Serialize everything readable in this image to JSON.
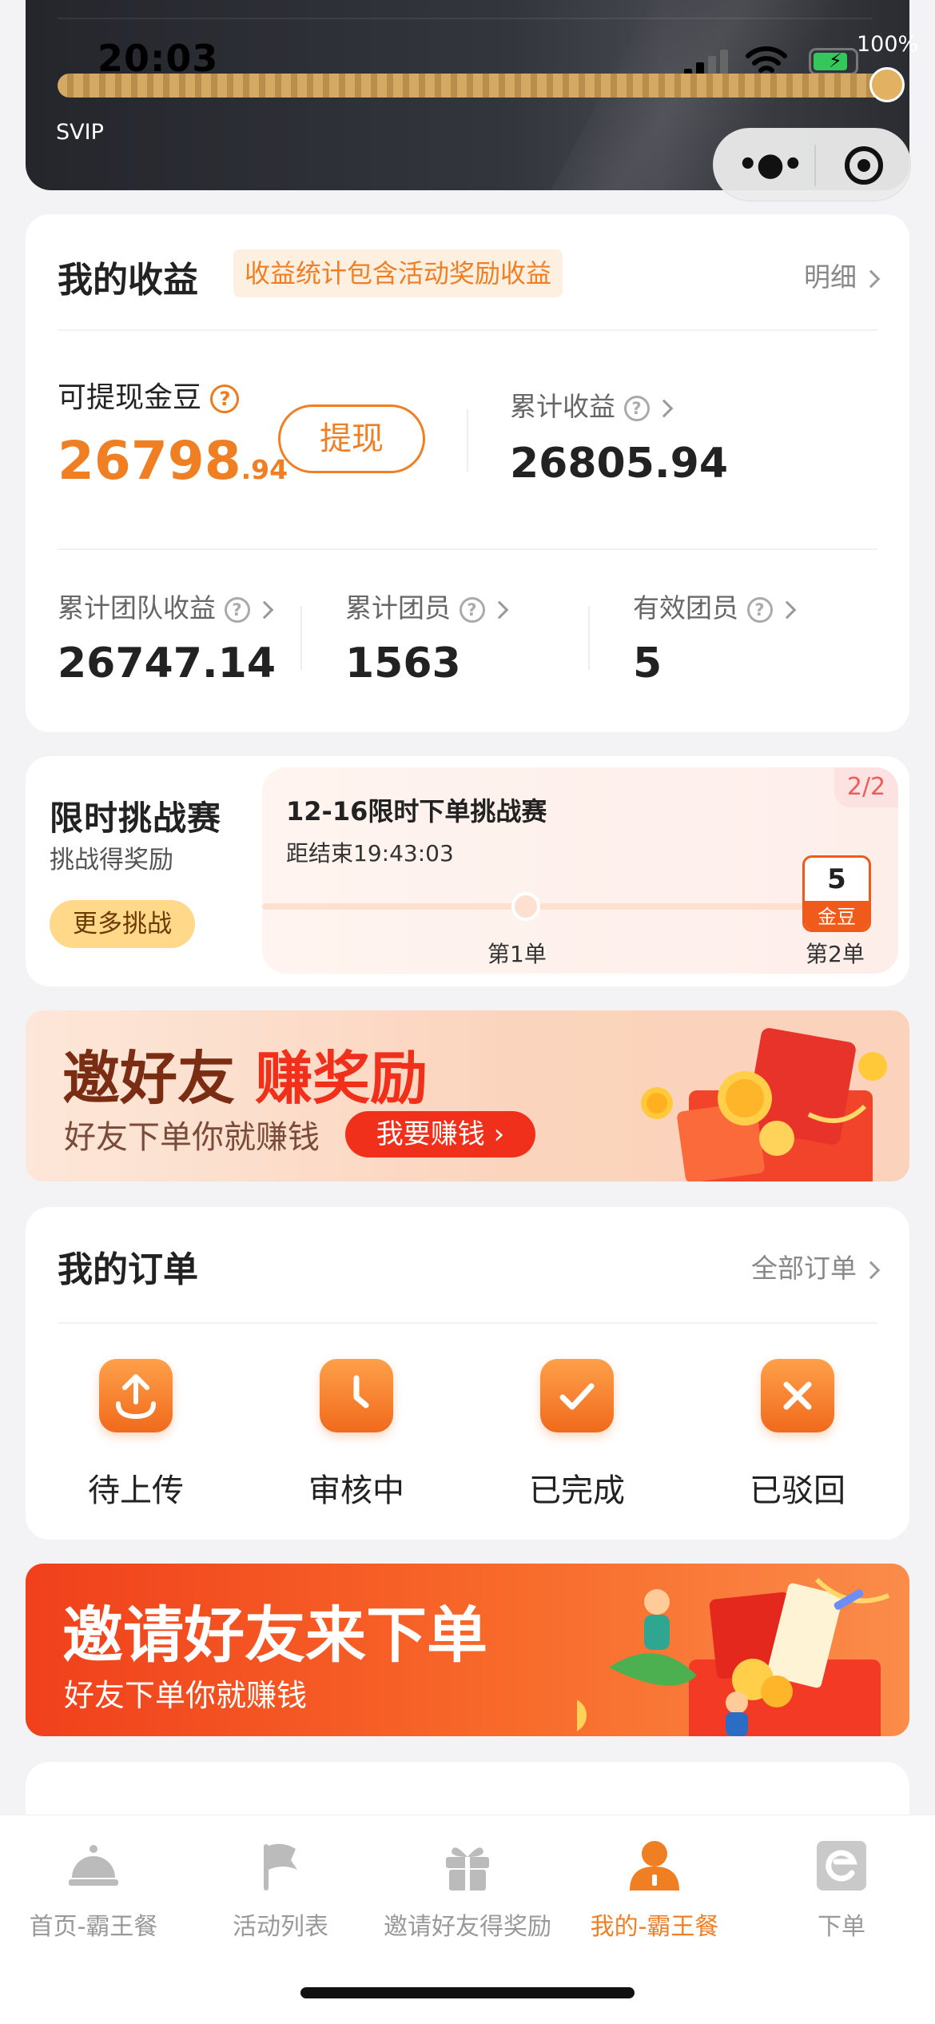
{
  "status_bar": {
    "time": "20:03",
    "battery_pct": "100%"
  },
  "header": {
    "level": "SVIP",
    "progress": 1.0
  },
  "earnings": {
    "title": "我的收益",
    "tag": "收益统计包含活动奖励收益",
    "detail_link": "明细",
    "withdrawable_label": "可提现金豆",
    "withdrawable_int": "26798",
    "withdrawable_dec": ".94",
    "withdraw_button": "提现",
    "total_label": "累计收益",
    "total_value": "26805.94",
    "team_earnings_label": "累计团队收益",
    "team_earnings_value": "26747.14",
    "team_members_label": "累计团员",
    "team_members_value": "1563",
    "valid_members_label": "有效团员",
    "valid_members_value": "5"
  },
  "challenge": {
    "title": "限时挑战赛",
    "subtitle": "挑战得奖励",
    "more_button": "更多挑战",
    "page": "2/2",
    "name": "12-16限时下单挑战赛",
    "countdown": "距结束19:43:03",
    "step1": "第1单",
    "step2": "第2单",
    "reward_amount": "5",
    "reward_unit": "金豆"
  },
  "invite_banner": {
    "title_a": "邀好友",
    "title_b": "赚奖励",
    "subtitle": "好友下单你就赚钱",
    "button": "我要赚钱"
  },
  "orders": {
    "title": "我的订单",
    "all_link": "全部订单",
    "items": [
      {
        "label": "待上传",
        "icon": "upload-icon"
      },
      {
        "label": "审核中",
        "icon": "clock-icon"
      },
      {
        "label": "已完成",
        "icon": "check-icon"
      },
      {
        "label": "已驳回",
        "icon": "close-icon"
      }
    ]
  },
  "invite_banner2": {
    "title": "邀请好友来下单",
    "subtitle": "好友下单你就赚钱"
  },
  "tabbar": {
    "items": [
      {
        "label": "首页-霸王餐",
        "icon": "cloche-icon",
        "active": false
      },
      {
        "label": "活动列表",
        "icon": "flag-icon",
        "active": false
      },
      {
        "label": "邀请好友得奖励",
        "icon": "gift-icon",
        "active": false
      },
      {
        "label": "我的-霸王餐",
        "icon": "user-icon",
        "active": true
      },
      {
        "label": "下单",
        "icon": "order-e-icon",
        "active": false
      }
    ]
  },
  "colors": {
    "accent": "#f07f24",
    "red": "#f0301a",
    "header_dark": "#2a2c31"
  }
}
